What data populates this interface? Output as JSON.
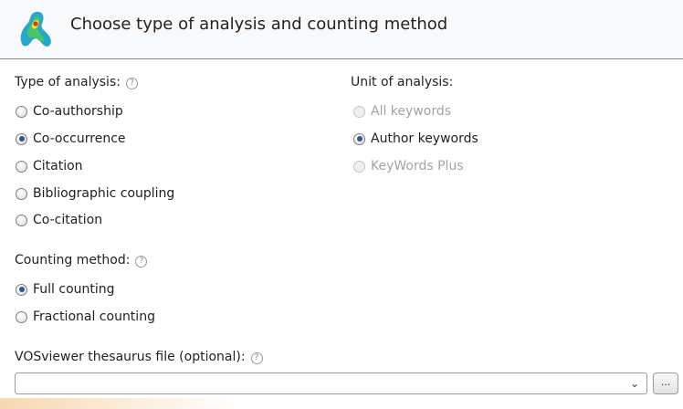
{
  "header": {
    "title": "Choose type of analysis and counting method",
    "logo_icon": "vosviewer-logo-icon"
  },
  "type_of_analysis": {
    "label": "Type of analysis:",
    "help_icon": "help-icon",
    "options": [
      {
        "label": "Co-authorship",
        "checked": false,
        "disabled": false
      },
      {
        "label": "Co-occurrence",
        "checked": true,
        "disabled": false
      },
      {
        "label": "Citation",
        "checked": false,
        "disabled": false
      },
      {
        "label": "Bibliographic coupling",
        "checked": false,
        "disabled": false
      },
      {
        "label": "Co-citation",
        "checked": false,
        "disabled": false
      }
    ]
  },
  "unit_of_analysis": {
    "label": "Unit of analysis:",
    "options": [
      {
        "label": "All keywords",
        "checked": false,
        "disabled": true
      },
      {
        "label": "Author keywords",
        "checked": true,
        "disabled": false
      },
      {
        "label": "KeyWords Plus",
        "checked": false,
        "disabled": true
      }
    ]
  },
  "counting_method": {
    "label": "Counting method:",
    "help_icon": "help-icon",
    "options": [
      {
        "label": "Full counting",
        "checked": true,
        "disabled": false
      },
      {
        "label": "Fractional counting",
        "checked": false,
        "disabled": false
      }
    ]
  },
  "thesaurus": {
    "label": "VOSviewer thesaurus file (optional):",
    "help_icon": "help-icon",
    "value": "",
    "browse_label": "..."
  },
  "colors": {
    "accent": "#2f5597",
    "marker": "#e0487a",
    "disabled_text": "#a3a3a3"
  }
}
